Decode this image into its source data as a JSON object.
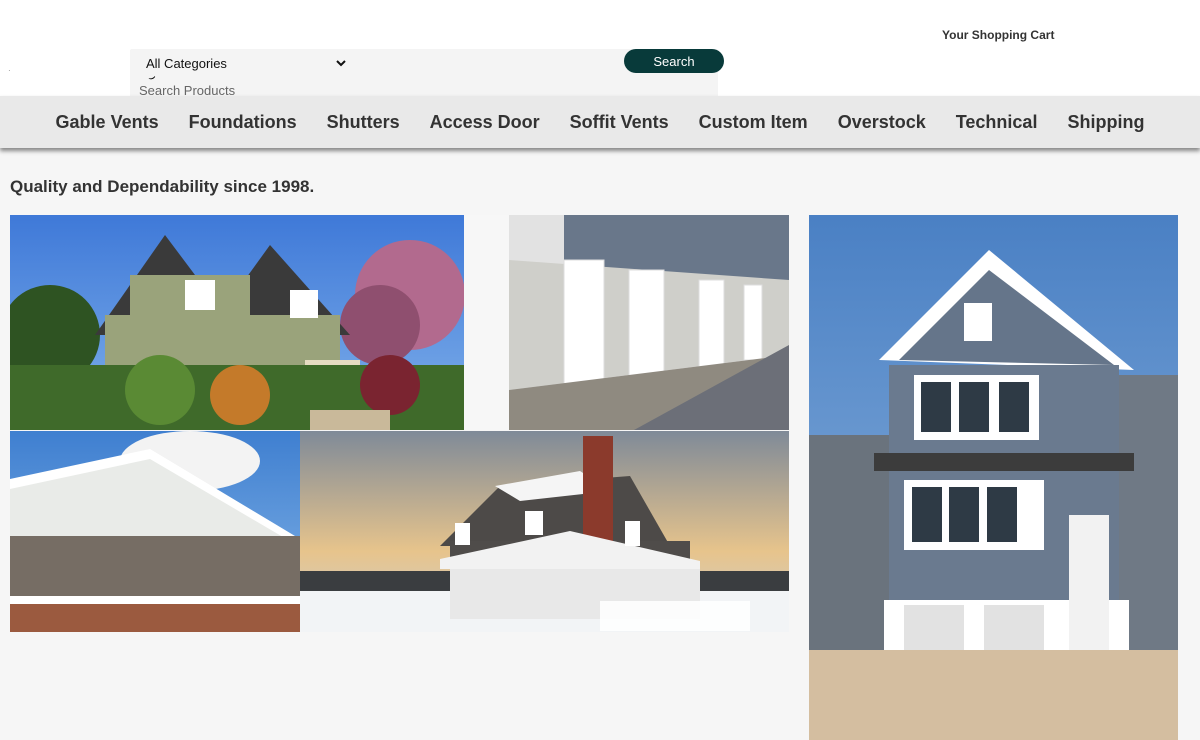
{
  "header": {
    "cart_label": "Your Shopping Cart",
    "category_options": [
      "All Categories"
    ],
    "category_selected": "All Categories",
    "search_placeholder": "Search Products",
    "search_button": "Search"
  },
  "nav": {
    "items": [
      "Gable Vents",
      "Foundations",
      "Shutters",
      "Access Door",
      "Soffit Vents",
      "Custom Item",
      "Overstock",
      "Technical",
      "Shipping"
    ]
  },
  "main": {
    "tagline": "Quality and Dependability since 1998."
  },
  "colors": {
    "search_button": "#083a3a",
    "nav_background": "#e9e9e9",
    "page_background": "#f6f6f6"
  }
}
